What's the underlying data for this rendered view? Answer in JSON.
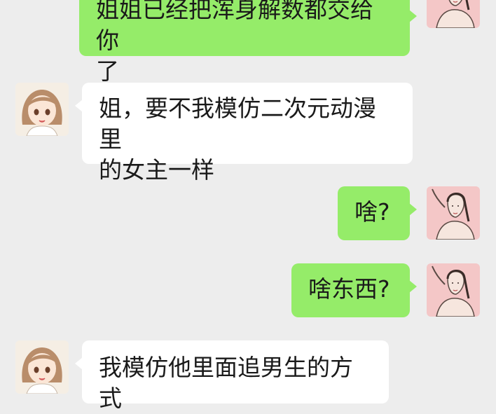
{
  "messages": [
    {
      "sender": "self",
      "text": "姐姐已经把浑身解数都交给你\n了",
      "avatar": "woman-stretching-avatar"
    },
    {
      "sender": "other",
      "text": "姐，要不我模仿二次元动漫里\n的女主一样",
      "avatar": "anime-girl-avatar"
    },
    {
      "sender": "self",
      "text": "啥?",
      "avatar": "woman-stretching-avatar"
    },
    {
      "sender": "self",
      "text": "啥东西?",
      "avatar": "woman-stretching-avatar"
    },
    {
      "sender": "other",
      "text": "我模仿他里面追男生的方式",
      "avatar": "anime-girl-avatar"
    }
  ],
  "colors": {
    "background": "#ededed",
    "self_bubble": "#95ec69",
    "other_bubble": "#ffffff",
    "self_avatar_bg": "#f4c7c7",
    "other_avatar_bg": "#f5eee4"
  }
}
